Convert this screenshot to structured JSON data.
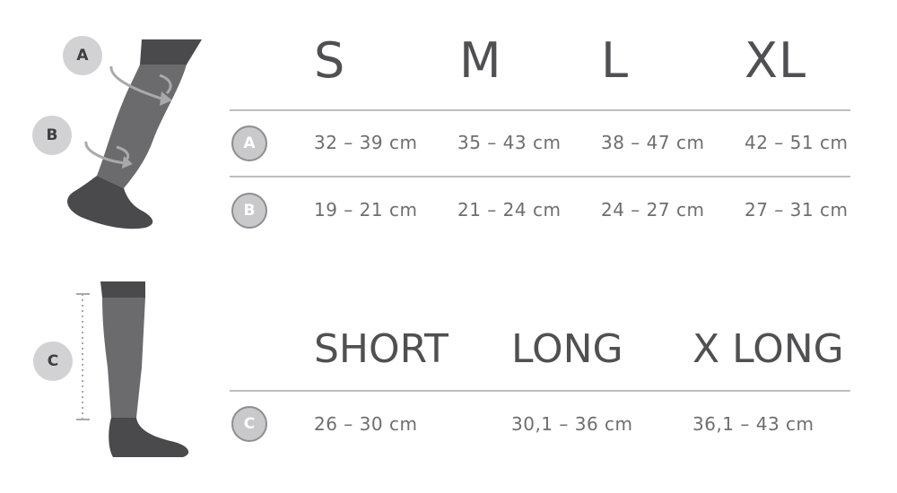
{
  "size_chart": {
    "sizes": [
      "S",
      "M",
      "L",
      "XL"
    ],
    "rows": [
      {
        "badge": "A",
        "values": [
          "32 – 39 cm",
          "35 – 43 cm",
          "38 – 47 cm",
          "42 – 51 cm"
        ]
      },
      {
        "badge": "B",
        "values": [
          "19 – 21 cm",
          "21 – 24 cm",
          "24 – 27 cm",
          "27 – 31 cm"
        ]
      }
    ]
  },
  "length_chart": {
    "lengths": [
      "SHORT",
      "LONG",
      "X LONG"
    ],
    "row": {
      "badge": "C",
      "values": [
        "26 – 30 cm",
        "30,1 – 36 cm",
        "36,1 – 43 cm"
      ]
    }
  },
  "illustration": {
    "labels": [
      "A",
      "B",
      "C"
    ],
    "sock_color": "#6b6b6d",
    "sock_dark": "#4a4a4c",
    "arrow_color": "#a9a9ab"
  }
}
